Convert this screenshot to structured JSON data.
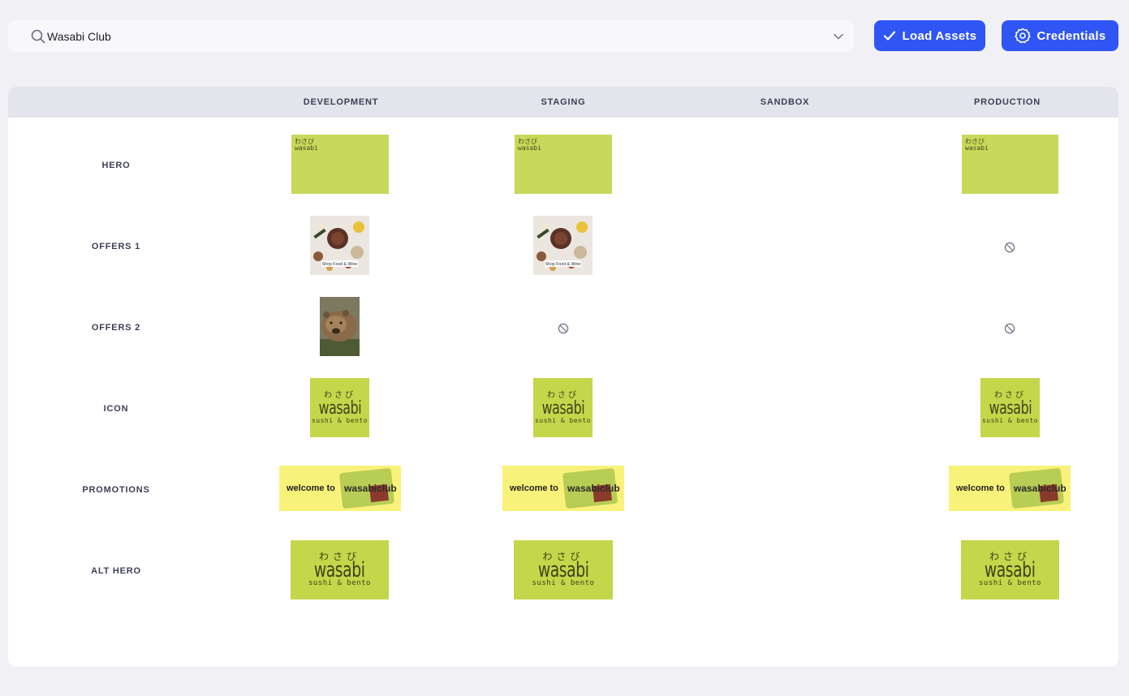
{
  "search": {
    "value": "Wasabi Club",
    "icon": "search-icon",
    "dropdown_icon": "chevron-down-icon"
  },
  "toolbar": {
    "load_label": "Load Assets",
    "load_icon": "check-icon",
    "credentials_label": "Credentials",
    "credentials_icon": "gear-icon"
  },
  "colors": {
    "accent": "#2f55f5",
    "background": "#f0f0f5",
    "header_row": "#e4e4ec",
    "brand_green": "#c4d64a",
    "promo_yellow": "#f9f27a"
  },
  "table": {
    "columns": [
      "DEVELOPMENT",
      "STAGING",
      "SANDBOX",
      "PRODUCTION"
    ],
    "rows": [
      {
        "label": "HERO",
        "cells": [
          "hero-banner-image",
          "hero-banner-image",
          "",
          "hero-banner-image"
        ]
      },
      {
        "label": "OFFERS 1",
        "cells": [
          "food-and-wine-image",
          "food-and-wine-image",
          "",
          "not-available"
        ]
      },
      {
        "label": "OFFERS 2",
        "cells": [
          "bear-photo-image",
          "not-available",
          "",
          "not-available"
        ]
      },
      {
        "label": "ICON",
        "cells": [
          "wasabi-logo-image",
          "wasabi-logo-image",
          "",
          "wasabi-logo-image"
        ]
      },
      {
        "label": "PROMOTIONS",
        "cells": [
          "welcome-banner-image",
          "welcome-banner-image",
          "",
          "welcome-banner-image"
        ]
      },
      {
        "label": "ALT HERO",
        "cells": [
          "wasabi-logo-image",
          "wasabi-logo-image",
          "",
          "wasabi-logo-image"
        ]
      }
    ]
  },
  "artwork_text": {
    "hero_mini": [
      "わさび",
      "wasabi",
      "sushi & bento"
    ],
    "logo_kana": "わさび",
    "logo_word": "wasabi",
    "logo_sub": "sushi & bento",
    "food_caption": "Shop Food & Wine",
    "promo_left": "welcome to",
    "promo_right": "wasabiclub"
  }
}
